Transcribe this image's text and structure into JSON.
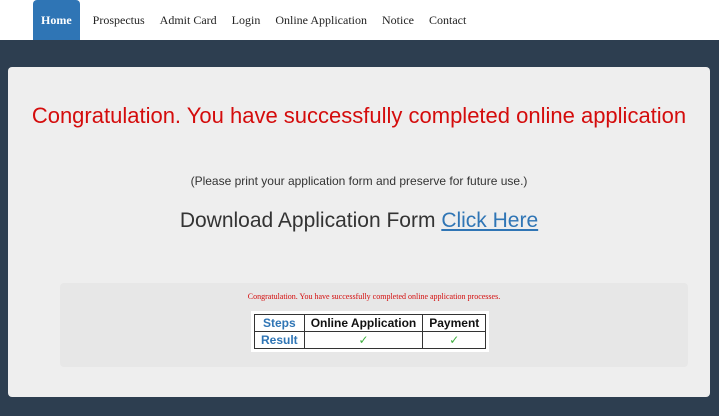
{
  "nav": {
    "items": [
      {
        "label": "Home",
        "active": true
      },
      {
        "label": "Prospectus"
      },
      {
        "label": "Admit Card"
      },
      {
        "label": "Login"
      },
      {
        "label": "Online Application"
      },
      {
        "label": "Notice"
      },
      {
        "label": "Contact"
      }
    ]
  },
  "main": {
    "headline": "Congratulation. You have successfully completed online application",
    "note": "(Please print your application form and preserve for future use.)",
    "download_text": "Download Application Form",
    "download_link": "Click Here"
  },
  "status": {
    "message": "Congratulation. You have successfully completed online application processes.",
    "table": {
      "header": [
        "Steps",
        "Online Application",
        "Payment"
      ],
      "row": [
        "Result",
        "✓",
        "✓"
      ]
    }
  },
  "colors": {
    "accent": "#2f75b5",
    "error_red": "#d40c0c",
    "success_green": "#3fae3f",
    "page_bg": "#2d3e50"
  }
}
